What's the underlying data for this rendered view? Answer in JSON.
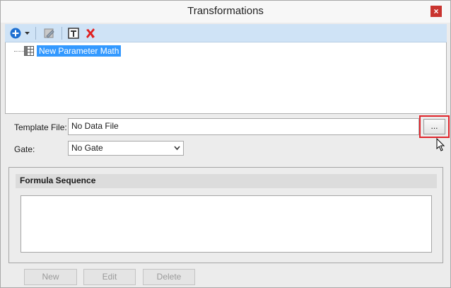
{
  "window": {
    "title": "Transformations",
    "close_glyph": "×"
  },
  "toolbar": {
    "add_icon": "plus-circle-icon",
    "dropdown_icon": "chevron-down-icon",
    "edit_icon": "edit-transform-icon",
    "rename_icon": "text-box-icon",
    "delete_icon": "red-x-icon"
  },
  "tree": {
    "items": [
      {
        "label": "New Parameter Math",
        "icon": "grid-table-icon"
      }
    ]
  },
  "template": {
    "label": "Template File:",
    "value": "No Data File",
    "browse_label": "..."
  },
  "gate": {
    "label": "Gate:",
    "value": "No Gate"
  },
  "formula": {
    "header": "Formula Sequence"
  },
  "actions": {
    "new_label": "New",
    "edit_label": "Edit",
    "delete_label": "Delete"
  },
  "colors": {
    "toolbar_bg": "#cfe3f6",
    "selection": "#3399ff",
    "highlight": "#e0252c",
    "close_bg": "#c9342f"
  }
}
